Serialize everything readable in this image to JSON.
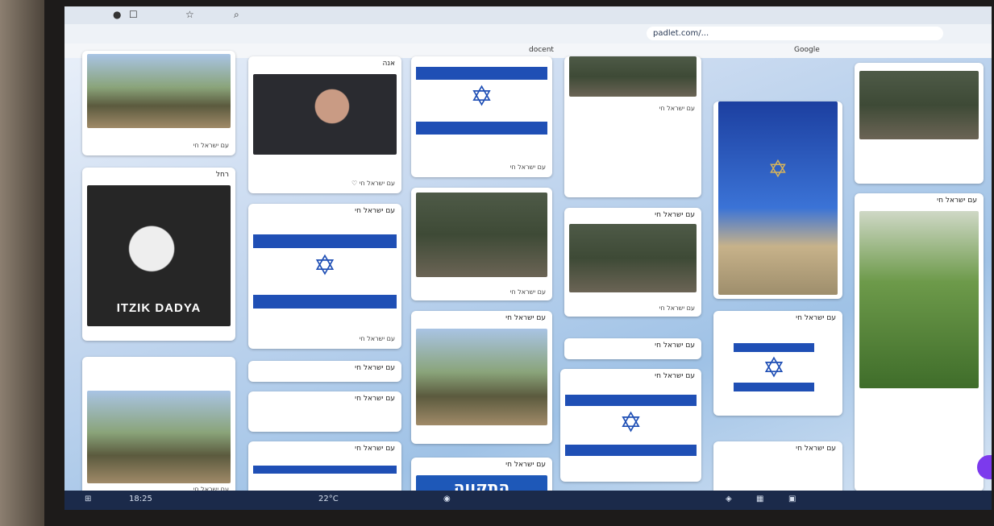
{
  "browser": {
    "url": "padlet.com/...",
    "bookmarks": [
      "docent",
      "Google"
    ]
  },
  "cards": {
    "c1": {
      "caption": "עם ישראל חי"
    },
    "c2": {
      "header": "אנה",
      "caption": "עם ישראל חי ♡"
    },
    "c3": {
      "caption": "עם ישראל חי"
    },
    "c4": {
      "header": "עם ישראל חי"
    },
    "c5": {
      "header": "עם ישראל חי"
    },
    "c6": {
      "header": "רחל"
    },
    "c7": {
      "album_title": "ITZIK DADYA"
    },
    "c8": {
      "header": "עם ישראל חי"
    },
    "c9": {
      "caption": "עם ישראל חי"
    },
    "c10": {
      "header": "עם ישראל חי",
      "caption": "עם ישראל חי"
    },
    "c11": {
      "header": "עם ישראל חי"
    },
    "c12": {
      "header": "עם ישראל חי"
    },
    "c13": {
      "header": "עם ישראל חי"
    },
    "c14": {
      "header": "עם ישראל חי"
    },
    "c15": {
      "header": "עם ישראל חי",
      "caption": "עם ישראל חי"
    },
    "c16": {
      "header": "עם ישראל חי"
    },
    "c17": {
      "caption": "עם ישראל חי"
    },
    "c18": {
      "header": "עם ישראל חי"
    },
    "c19": {
      "header": "עם ישראל חי"
    },
    "c20": {
      "header": "עם ישראל חי",
      "banner": "התקווה"
    },
    "c21": {
      "caption": "עם ישראל חי"
    }
  },
  "taskbar": {
    "time": "18:25",
    "weather": "22°C"
  },
  "colors": {
    "flag_blue": "#1f4fb5",
    "padlet_fab": "#7c3aed",
    "taskbar": "#1b2a4a"
  }
}
